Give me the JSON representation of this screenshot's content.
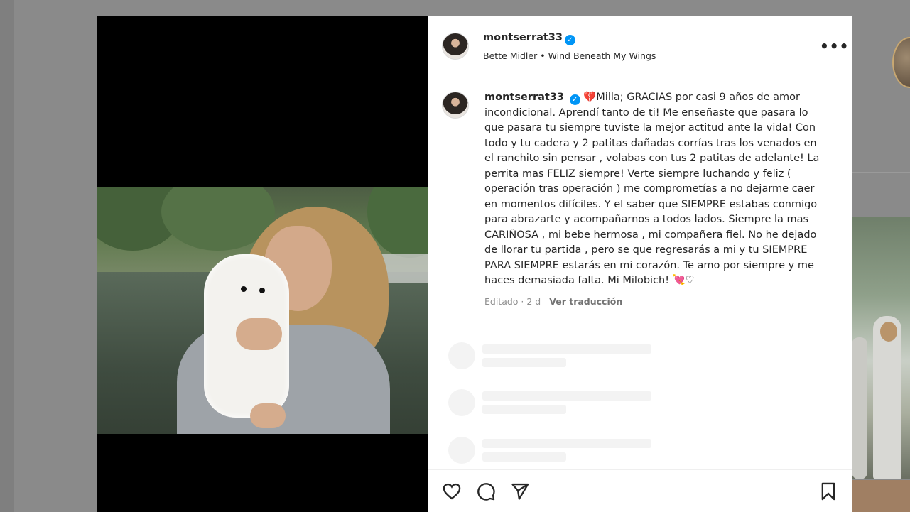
{
  "post": {
    "username": "montserrat33",
    "verified_glyph": "✓",
    "music": {
      "artist": "Bette Midler",
      "separator": "•",
      "song": "Wind Beneath My Wings"
    },
    "more_label": "•••",
    "caption": {
      "username": "montserrat33",
      "emoji_start": "💔",
      "text": "Milla; GRACIAS por casi 9 años de amor incondicional. Aprendí tanto de ti! Me enseñaste que pasara lo que pasara tu siempre tuviste la mejor actitud ante la vida! Con todo y tu cadera y 2 patitas dañadas corrías tras los venados en el ranchito sin pensar , volabas con tus 2 patitas de adelante! La perrita mas FELIZ siempre! Verte siempre luchando y feliz ( operación tras operación ) me comprometías a no dejarme caer en momentos difíciles. Y el saber que SIEMPRE estabas conmigo para abrazarte y acompañarnos a todos lados. Siempre la mas CARIÑOSA , mi bebe hermosa , mi compañera fiel. No he dejado de llorar tu partida , pero se que regresarás a mi y tu SIEMPRE PARA SIEMPRE estarás en mi corazón. Te amo por siempre y me haces demasiada falta. Mi Milobich!",
      "emoji_end": "💘♡"
    },
    "meta": {
      "edited": "Editado · 2 d",
      "translate": "Ver traducción"
    }
  },
  "icons": {
    "like": "heart-outline-icon",
    "comment": "comment-bubble-icon",
    "share": "paper-plane-icon",
    "save": "bookmark-icon"
  },
  "colors": {
    "verified": "#0095f6",
    "text": "#262626",
    "muted": "#8e8e8e",
    "backdrop": "#7f7f7f"
  }
}
